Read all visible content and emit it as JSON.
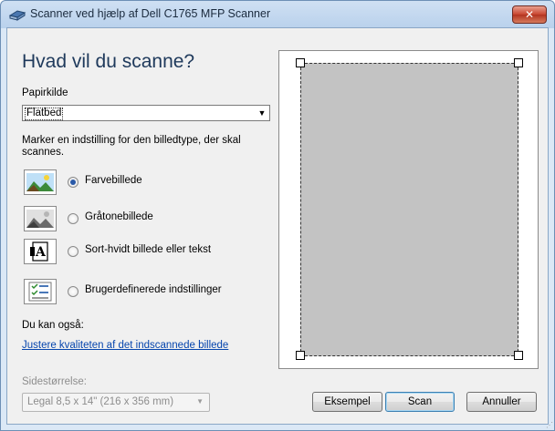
{
  "window": {
    "title": "Scanner ved hjælp af Dell C1765 MFP Scanner",
    "close_glyph": "✕"
  },
  "heading": "Hvad vil du scanne?",
  "source": {
    "label": "Papirkilde",
    "value": "Flatbed"
  },
  "instruction": "Marker en indstilling for den billedtype, der skal scannes.",
  "options": [
    {
      "label": "Farvebillede",
      "selected": true,
      "icon": "color-picture-icon"
    },
    {
      "label": "Gråtonebillede",
      "selected": false,
      "icon": "grayscale-picture-icon"
    },
    {
      "label": "Sort-hvidt billede eller tekst",
      "selected": false,
      "icon": "black-white-text-icon"
    },
    {
      "label": "Brugerdefinerede indstillinger",
      "selected": false,
      "icon": "custom-settings-icon"
    }
  ],
  "also": {
    "label": "Du kan også:",
    "link": "Justere kvaliteten af det indscannede billede"
  },
  "page_size": {
    "label": "Sidestørrelse:",
    "value": "Legal 8,5 x 14\" (216 x 356 mm)"
  },
  "buttons": {
    "preview": "Eksempel",
    "scan": "Scan",
    "cancel": "Annuller"
  },
  "colors": {
    "title_bg": "#cfe0f3",
    "link": "#0645ad",
    "scan_area": "#c3c3c3"
  }
}
